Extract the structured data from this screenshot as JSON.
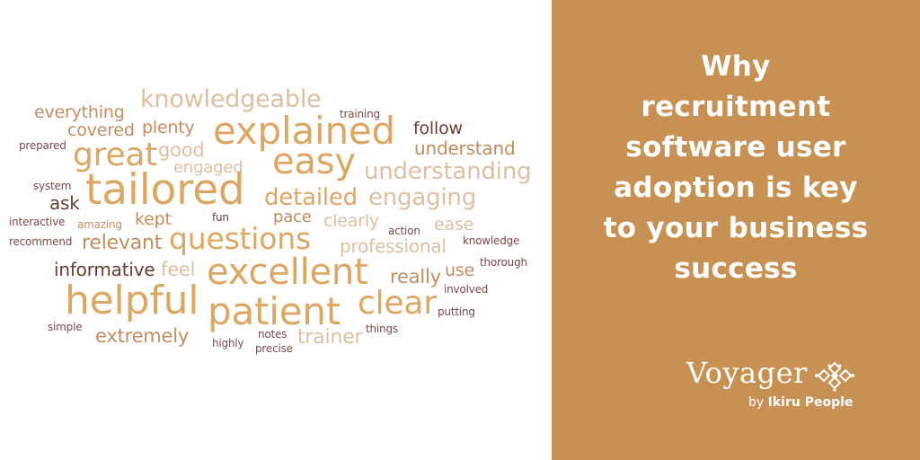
{
  "palette": {
    "panel_bg": "#c69152",
    "panel_text": "#ffffff",
    "tiers": {
      "gold": "#dca663",
      "tan": "#c38d5e",
      "beige": "#dcc0a0",
      "brown": "#6a3d33",
      "mauve": "#7b4a4a"
    }
  },
  "word_cloud": {
    "words": [
      {
        "text": "knowledgeable",
        "tier": "beige"
      },
      {
        "text": "everything",
        "tier": "tan"
      },
      {
        "text": "training",
        "tier": "mauve"
      },
      {
        "text": "covered",
        "tier": "tan"
      },
      {
        "text": "plenty",
        "tier": "tan"
      },
      {
        "text": "explained",
        "tier": "gold"
      },
      {
        "text": "follow",
        "tier": "brown"
      },
      {
        "text": "prepared",
        "tier": "mauve"
      },
      {
        "text": "great",
        "tier": "gold"
      },
      {
        "text": "good",
        "tier": "beige"
      },
      {
        "text": "understand",
        "tier": "tan"
      },
      {
        "text": "easy",
        "tier": "gold"
      },
      {
        "text": "engaged",
        "tier": "beige"
      },
      {
        "text": "understanding",
        "tier": "beige"
      },
      {
        "text": "system",
        "tier": "mauve"
      },
      {
        "text": "tailored",
        "tier": "gold"
      },
      {
        "text": "detailed",
        "tier": "gold"
      },
      {
        "text": "engaging",
        "tier": "beige"
      },
      {
        "text": "ask",
        "tier": "brown"
      },
      {
        "text": "interactive",
        "tier": "mauve"
      },
      {
        "text": "amazing",
        "tier": "tan"
      },
      {
        "text": "kept",
        "tier": "tan"
      },
      {
        "text": "fun",
        "tier": "brown"
      },
      {
        "text": "pace",
        "tier": "tan"
      },
      {
        "text": "clearly",
        "tier": "beige"
      },
      {
        "text": "action",
        "tier": "mauve"
      },
      {
        "text": "ease",
        "tier": "beige"
      },
      {
        "text": "recommend",
        "tier": "mauve"
      },
      {
        "text": "relevant",
        "tier": "tan"
      },
      {
        "text": "questions",
        "tier": "gold"
      },
      {
        "text": "professional",
        "tier": "beige"
      },
      {
        "text": "knowledge",
        "tier": "mauve"
      },
      {
        "text": "informative",
        "tier": "brown"
      },
      {
        "text": "feel",
        "tier": "beige"
      },
      {
        "text": "excellent",
        "tier": "gold"
      },
      {
        "text": "thorough",
        "tier": "mauve"
      },
      {
        "text": "really",
        "tier": "tan"
      },
      {
        "text": "use",
        "tier": "tan"
      },
      {
        "text": "involved",
        "tier": "mauve"
      },
      {
        "text": "helpful",
        "tier": "gold"
      },
      {
        "text": "patient",
        "tier": "gold"
      },
      {
        "text": "clear",
        "tier": "gold"
      },
      {
        "text": "putting",
        "tier": "mauve"
      },
      {
        "text": "simple",
        "tier": "mauve"
      },
      {
        "text": "extremely",
        "tier": "tan"
      },
      {
        "text": "things",
        "tier": "mauve"
      },
      {
        "text": "notes",
        "tier": "mauve"
      },
      {
        "text": "trainer",
        "tier": "beige"
      },
      {
        "text": "highly",
        "tier": "mauve"
      },
      {
        "text": "precise",
        "tier": "mauve"
      }
    ]
  },
  "headline": {
    "lines": [
      "Why",
      "recruitment",
      "software user",
      "adoption is key",
      "to your business",
      "success"
    ]
  },
  "brand": {
    "name": "Voyager",
    "by": "by",
    "company": "Ikiru People",
    "logo_icon": "puzzle-cross-icon"
  }
}
